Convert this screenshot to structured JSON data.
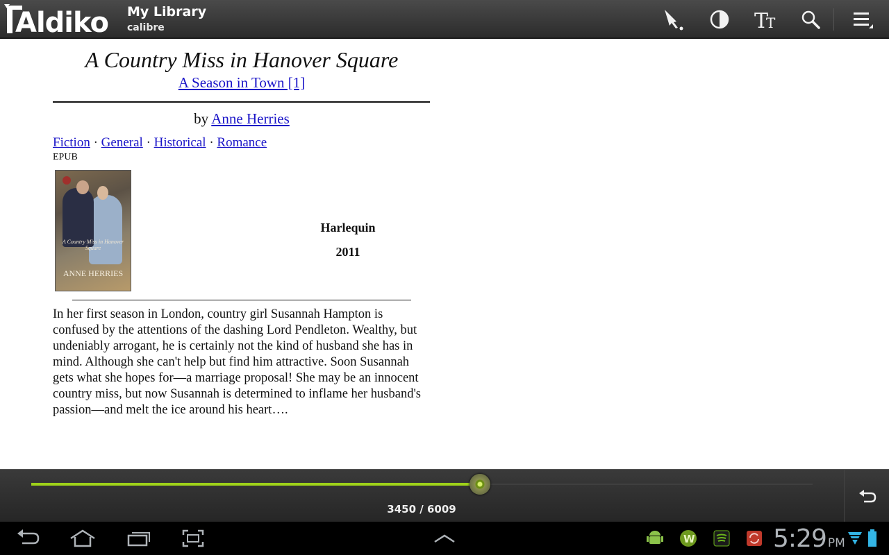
{
  "actionbar": {
    "logo_text": "Aldiko",
    "title": "My Library",
    "subtitle": "calibre",
    "icons": [
      "bookmark-icon",
      "contrast-icon",
      "font-size-icon",
      "search-icon",
      "menu-icon"
    ]
  },
  "book": {
    "title": "A Country Miss in Hanover Square",
    "series": "A Season in Town [1]",
    "by": "by",
    "author": "Anne Herries",
    "tags": [
      "Fiction",
      "General",
      "Historical",
      "Romance"
    ],
    "tag_separator": "·",
    "format": "EPUB",
    "cover_small_text": "A Country Miss in Hanover Square",
    "cover_author": "ANNE HERRIES",
    "publisher": "Harlequin",
    "year": "2011",
    "description": "In her first season in London, country girl Susannah Hampton is confused by the attentions of the dashing Lord Pendleton. Wealthy, but undeniably arrogant, he is certainly not the kind of husband she has in mind. Although she can't help but find him attractive. Soon Susannah gets what she hopes for—a marriage proposal! She may be an innocent country miss, but now Susannah is determined to inflame her husband's passion—and melt the ice around his heart…."
  },
  "progress": {
    "current_page": 3450,
    "total_pages": 6009,
    "label": "3450 / 6009",
    "fraction": 0.574
  },
  "systembar": {
    "time": "5:29",
    "ampm": "PM",
    "nav_icons": [
      "back-icon",
      "home-icon",
      "recent-apps-icon",
      "screenshot-icon",
      "up-chevron-icon"
    ],
    "notification_icons": [
      "android-debug-icon",
      "w-app-icon",
      "spotify-icon",
      "sync-icon",
      "wifi-icon",
      "battery-icon"
    ]
  },
  "colors": {
    "accent": "#9fd21a",
    "link": "#1a14c8",
    "bar_bg": "#2c2c2c"
  }
}
